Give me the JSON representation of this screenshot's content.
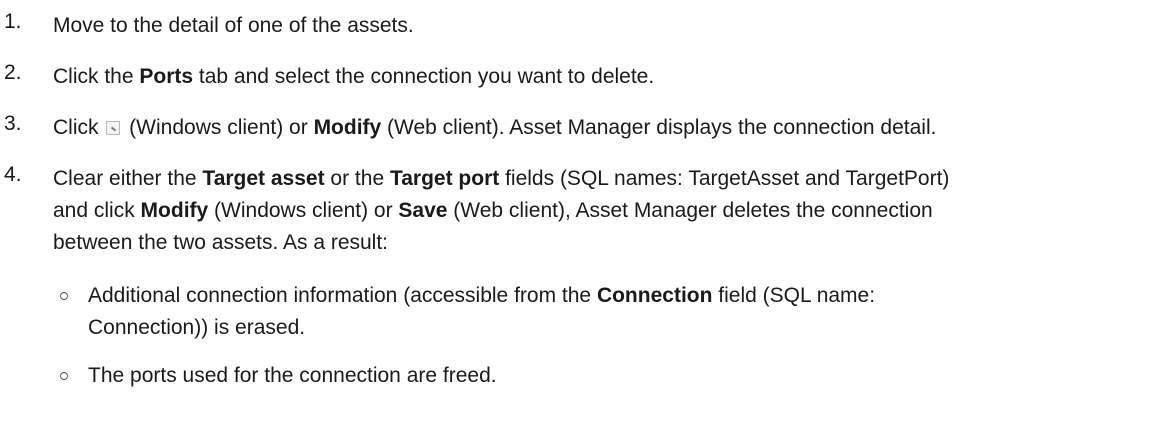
{
  "steps": [
    {
      "number": "1.",
      "parts": [
        {
          "text": "Move to the detail of one of the assets."
        }
      ]
    },
    {
      "number": "2.",
      "parts": [
        {
          "text": "Click the "
        },
        {
          "bold": "Ports"
        },
        {
          "text": " tab and select the connection you want to delete."
        }
      ]
    },
    {
      "number": "3.",
      "parts": [
        {
          "text": "Click "
        },
        {
          "text": " (Windows client) or "
        },
        {
          "bold": "Modify"
        },
        {
          "text": " (Web client). Asset Manager displays the connection detail."
        }
      ],
      "icon": "modify-icon"
    },
    {
      "number": "4.",
      "lines": [
        [
          {
            "text": "Clear either the "
          },
          {
            "bold": "Target asset"
          },
          {
            "text": " or the "
          },
          {
            "bold": "Target port"
          },
          {
            "text": " fields (SQL names: TargetAsset and TargetPort)"
          }
        ],
        [
          {
            "text": "and click "
          },
          {
            "bold": "Modify"
          },
          {
            "text": " (Windows client) or "
          },
          {
            "bold": "Save"
          },
          {
            "text": " (Web client), Asset Manager deletes the connection"
          }
        ],
        [
          {
            "text": "between the two assets. As a result:"
          }
        ]
      ]
    }
  ],
  "sub_items": [
    {
      "lines": [
        [
          {
            "text": "Additional connection information (accessible from the "
          },
          {
            "bold": "Connection"
          },
          {
            "text": " field (SQL name:"
          }
        ],
        [
          {
            "text": "Connection)) is erased."
          }
        ]
      ]
    },
    {
      "lines": [
        [
          {
            "text": "The ports used for the connection are freed."
          }
        ]
      ]
    }
  ]
}
